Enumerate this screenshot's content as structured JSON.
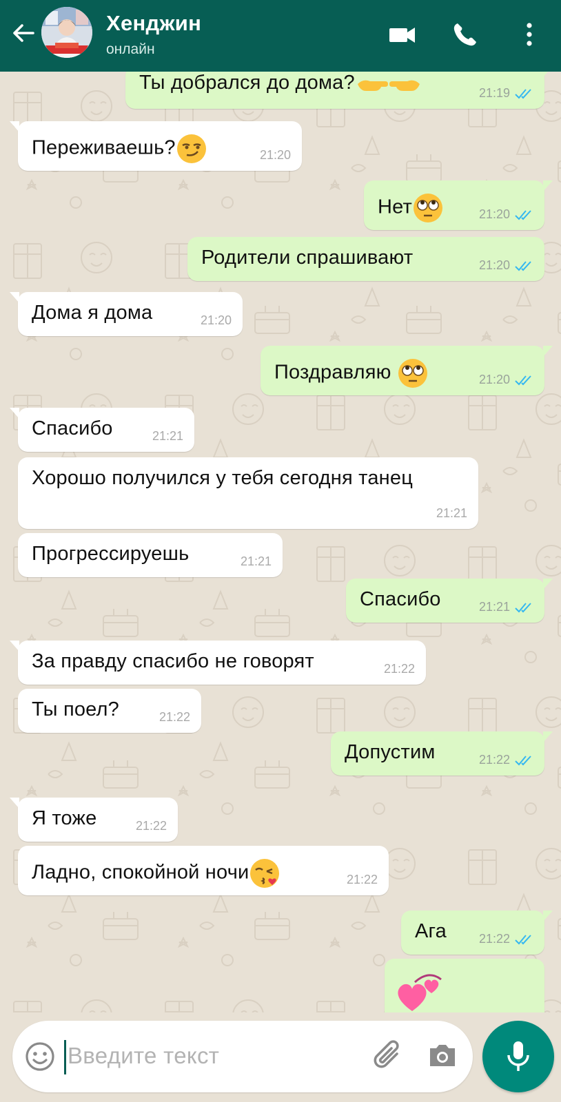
{
  "header": {
    "contact_name": "Хенджин",
    "contact_status": "онлайн"
  },
  "icons": {
    "back": "arrow-left-icon",
    "video": "video-camera-icon",
    "call": "phone-icon",
    "more": "more-vertical-icon",
    "emoji": "smiley-icon",
    "attach": "paperclip-icon",
    "camera": "camera-icon",
    "mic": "microphone-icon"
  },
  "colors": {
    "header": "#075e54",
    "outgoing_bubble": "#dcf8c6",
    "incoming_bubble": "#ffffff",
    "read_ticks": "#34b7f1",
    "mic_button": "#00897b",
    "background": "#e8e1d5"
  },
  "messages": [
    {
      "dir": "out",
      "text": "Ты добрался до дома?",
      "emoji": "pointing-hands",
      "time": "21:19"
    },
    {
      "dir": "in",
      "text": "Переживаешь?",
      "emoji": "smirk",
      "time": "21:20"
    },
    {
      "dir": "out",
      "text": "Нет",
      "emoji": "eye-roll",
      "time": "21:20"
    },
    {
      "dir": "out",
      "text": "Родители спрашивают",
      "time": "21:20"
    },
    {
      "dir": "in",
      "text": "Дома я дома",
      "time": "21:20"
    },
    {
      "dir": "out",
      "text": "Поздравляю",
      "emoji": "eye-roll",
      "time": "21:20"
    },
    {
      "dir": "in",
      "text": "Спасибо",
      "time": "21:21"
    },
    {
      "dir": "in",
      "text": "Хорошо получился у тебя сегодня танец",
      "time": "21:21"
    },
    {
      "dir": "in",
      "text": "Прогрессируешь",
      "time": "21:21"
    },
    {
      "dir": "out",
      "text": "Спасибо",
      "time": "21:21"
    },
    {
      "dir": "in",
      "text": "За правду спасибо не говорят",
      "time": "21:22"
    },
    {
      "dir": "in",
      "text": "Ты поел?",
      "time": "21:22"
    },
    {
      "dir": "out",
      "text": "Допустим",
      "time": "21:22"
    },
    {
      "dir": "in",
      "text": "Я тоже",
      "time": "21:22"
    },
    {
      "dir": "in",
      "text": "Ладно, спокойной ночи",
      "emoji": "kiss",
      "time": "21:22"
    },
    {
      "dir": "out",
      "text": "Ага",
      "time": "21:22"
    },
    {
      "dir": "out",
      "text": "",
      "emoji": "revolving-hearts",
      "time": ""
    }
  ],
  "input": {
    "placeholder": "Введите текст"
  }
}
